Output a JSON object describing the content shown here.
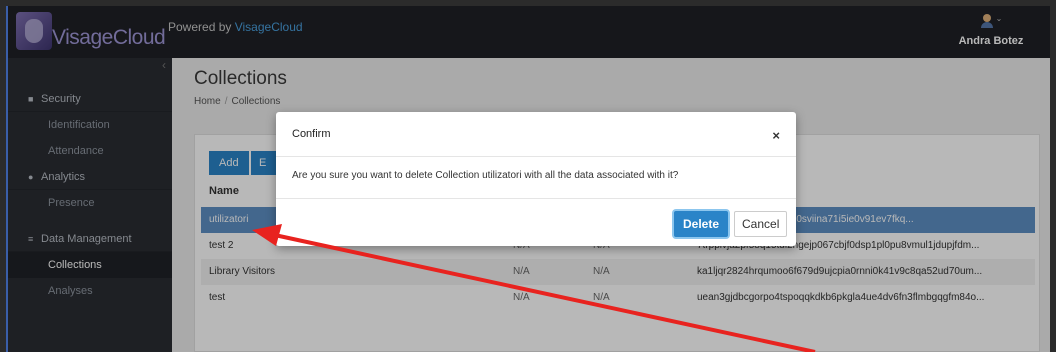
{
  "header": {
    "logo_text": "VisageCloud",
    "powered_prefix": "Powered by",
    "powered_link": "VisageCloud",
    "user_name": "Andra Botez"
  },
  "sidebar": {
    "sections": [
      {
        "label": "Security",
        "icon": "video-camera-icon",
        "items": [
          "Identification",
          "Attendance"
        ]
      },
      {
        "label": "Analytics",
        "icon": "gauge-icon",
        "items": [
          "Presence"
        ]
      },
      {
        "label": "Data Management",
        "icon": "list-icon",
        "items": [
          "Collections",
          "Analyses"
        ]
      }
    ],
    "active_item": "Collections"
  },
  "main": {
    "title": "Collections",
    "breadcrumb": {
      "home": "Home",
      "sep": "/",
      "current": "Collections"
    },
    "buttons": {
      "add": "Add",
      "edit": "E"
    },
    "table": {
      "header_name": "Name",
      "rows": [
        {
          "name": "utilizatori",
          "c2": "",
          "c3": "",
          "key": "ugjhff2762gq4kaj8jlstq0sviina71i5ie0v91ev7fkq..."
        },
        {
          "name": "test 2",
          "c2": "N/A",
          "c3": "N/A",
          "key": "7trppivja2pf58q15tdi2ngejp067cbjf0dsp1pl0pu8vmul1jdupjfdm..."
        },
        {
          "name": "Library Visitors",
          "c2": "N/A",
          "c3": "N/A",
          "key": "ka1ljqr2824hrqumoo6f679d9ujcpia0rnni0k41v9c8qa52ud70um..."
        },
        {
          "name": "test",
          "c2": "N/A",
          "c3": "N/A",
          "key": "uean3gjdbcgorpo4tspoqqkdkb6pkgla4ue4dv6fn3flmbgqgfm84o..."
        }
      ]
    }
  },
  "modal": {
    "title": "Confirm",
    "close": "×",
    "body": "Are you sure you want to delete Collection utilizatori with all the data associated with it?",
    "delete_label": "Delete",
    "cancel_label": "Cancel"
  },
  "colors": {
    "accent": "#2a84c8",
    "selected_row": "#5d8fc4",
    "annotation": "#e8231f"
  }
}
